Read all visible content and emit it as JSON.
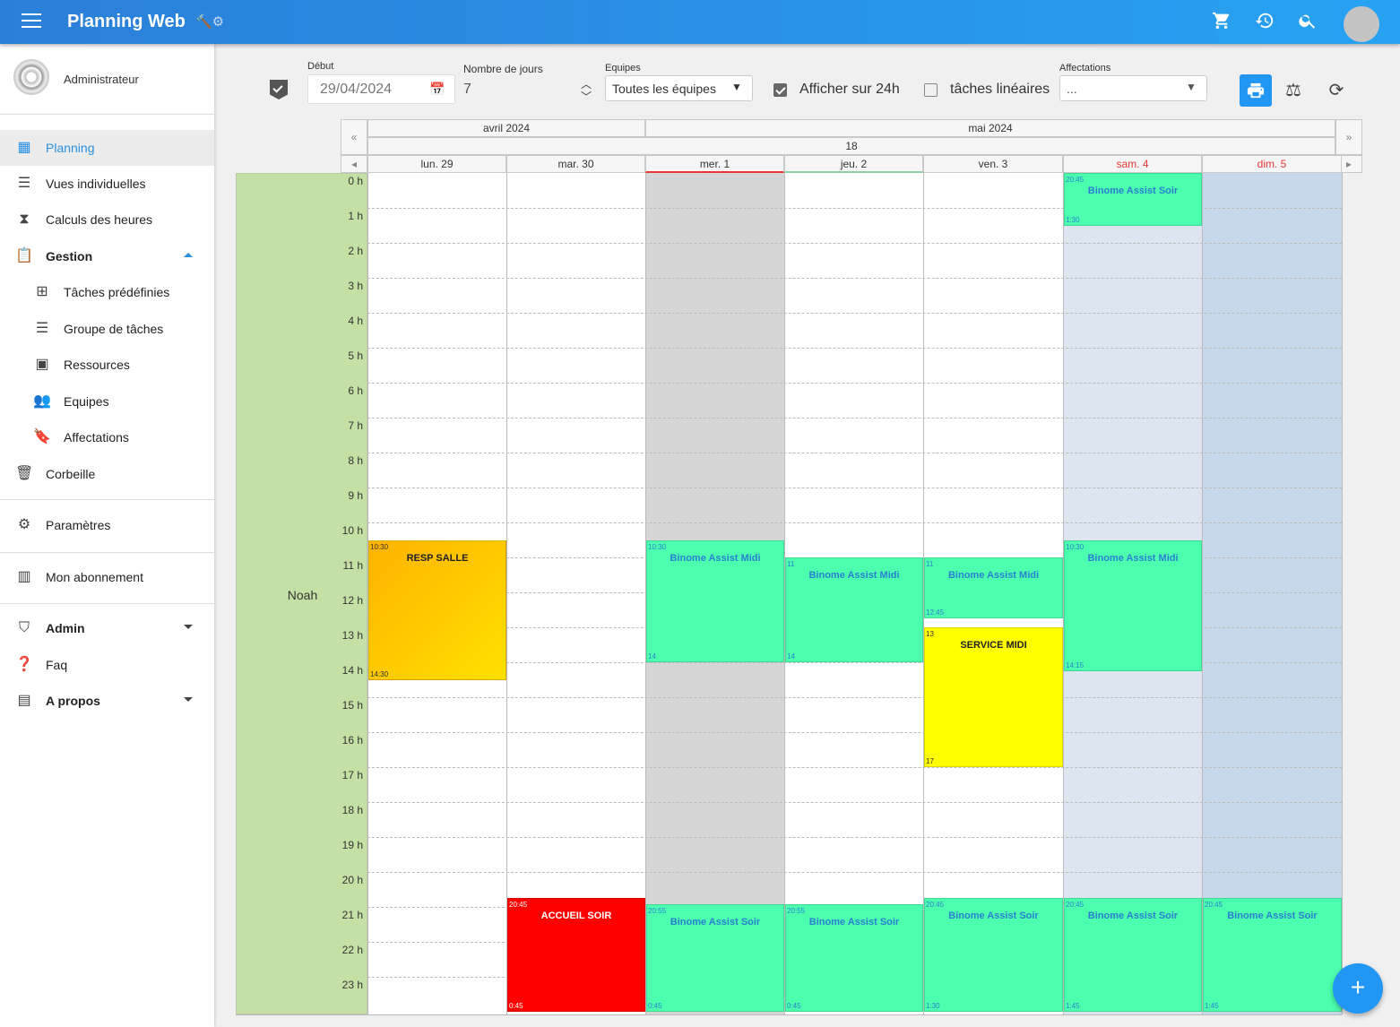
{
  "app": {
    "title": "Planning Web",
    "tools_icons": "🔨⚙"
  },
  "topbar_icons": [
    "cart-icon",
    "history-icon",
    "search-icon"
  ],
  "user": {
    "name": "Administrateur"
  },
  "nav": {
    "planning": "Planning",
    "vues": "Vues individuelles",
    "calculs": "Calculs des heures",
    "gestion": "Gestion",
    "taches": "Tâches prédéfinies",
    "groupe": "Groupe de tâches",
    "ressources": "Ressources",
    "equipes": "Equipes",
    "affectations": "Affectations",
    "corbeille": "Corbeille",
    "parametres": "Paramètres",
    "abonnement": "Mon abonnement",
    "admin": "Admin",
    "faq": "Faq",
    "apropos": "A propos"
  },
  "toolbar": {
    "debut_label": "Début",
    "debut_value": "29/04/2024",
    "nbjours_label": "Nombre de jours",
    "nbjours_value": "7",
    "equipes_label": "Equipes",
    "equipes_value": "Toutes les équipes",
    "afficher24_label": "Afficher sur 24h",
    "afficher24_checked": true,
    "lineaires_label": "tâches linéaires",
    "lineaires_checked": false,
    "affectations_label": "Affectations",
    "affectations_value": "..."
  },
  "calendar": {
    "months": [
      "avril 2024",
      "mai 2024"
    ],
    "week": "18",
    "days": [
      "lun. 29",
      "mar. 30",
      "mer. 1",
      "jeu. 2",
      "ven. 3",
      "sam. 4",
      "dim. 5"
    ],
    "resource": "Noah",
    "hours": [
      "0 h",
      "1 h",
      "2 h",
      "3 h",
      "4 h",
      "5 h",
      "6 h",
      "7 h",
      "8 h",
      "9 h",
      "10 h",
      "11 h",
      "12 h",
      "13 h",
      "14 h",
      "15 h",
      "16 h",
      "17 h",
      "18 h",
      "19 h",
      "20 h",
      "21 h",
      "22 h",
      "23 h"
    ]
  },
  "events": [
    {
      "day": 0,
      "start": "10:30",
      "end": "14:30",
      "title": "RESP SALLE",
      "color": "#ffc800",
      "style": "orange"
    },
    {
      "day": 1,
      "start": "20:45",
      "end": "0:45",
      "title": "ACCUEIL SOIR",
      "color": "#ff0000",
      "style": "red"
    },
    {
      "day": 2,
      "start": "10:30",
      "end": "14",
      "title": "Binome Assist Midi",
      "style": "green"
    },
    {
      "day": 2,
      "start": "20:55",
      "end": "0:45",
      "title": "Binome Assist Soir",
      "style": "green"
    },
    {
      "day": 3,
      "start": "11",
      "end": "14",
      "title": "Binome Assist Midi",
      "style": "green"
    },
    {
      "day": 3,
      "start": "20:55",
      "end": "0:45",
      "title": "Binome Assist Soir",
      "style": "green"
    },
    {
      "day": 4,
      "start": "11",
      "end": "12:45",
      "title": "Binome Assist Midi",
      "style": "green"
    },
    {
      "day": 4,
      "start": "13",
      "end": "17",
      "title": "SERVICE MIDI",
      "color": "#ffff00",
      "style": "yellow"
    },
    {
      "day": 4,
      "start": "20:45",
      "end": "1:30",
      "title": "Binome Assist Soir",
      "style": "green"
    },
    {
      "day": 5,
      "start": "20:45",
      "end": "1:30",
      "title": "Binome Assist Soir",
      "style": "green"
    },
    {
      "day": 5,
      "start": "10:30",
      "end": "14:15",
      "title": "Binome Assist Midi",
      "style": "green"
    },
    {
      "day": 5,
      "start": "20:45",
      "end": "1:45",
      "title": "Binome Assist Soir",
      "style": "green"
    },
    {
      "day": 6,
      "start": "20:45",
      "end": "1:45",
      "title": "Binome Assist Soir",
      "style": "green"
    }
  ]
}
